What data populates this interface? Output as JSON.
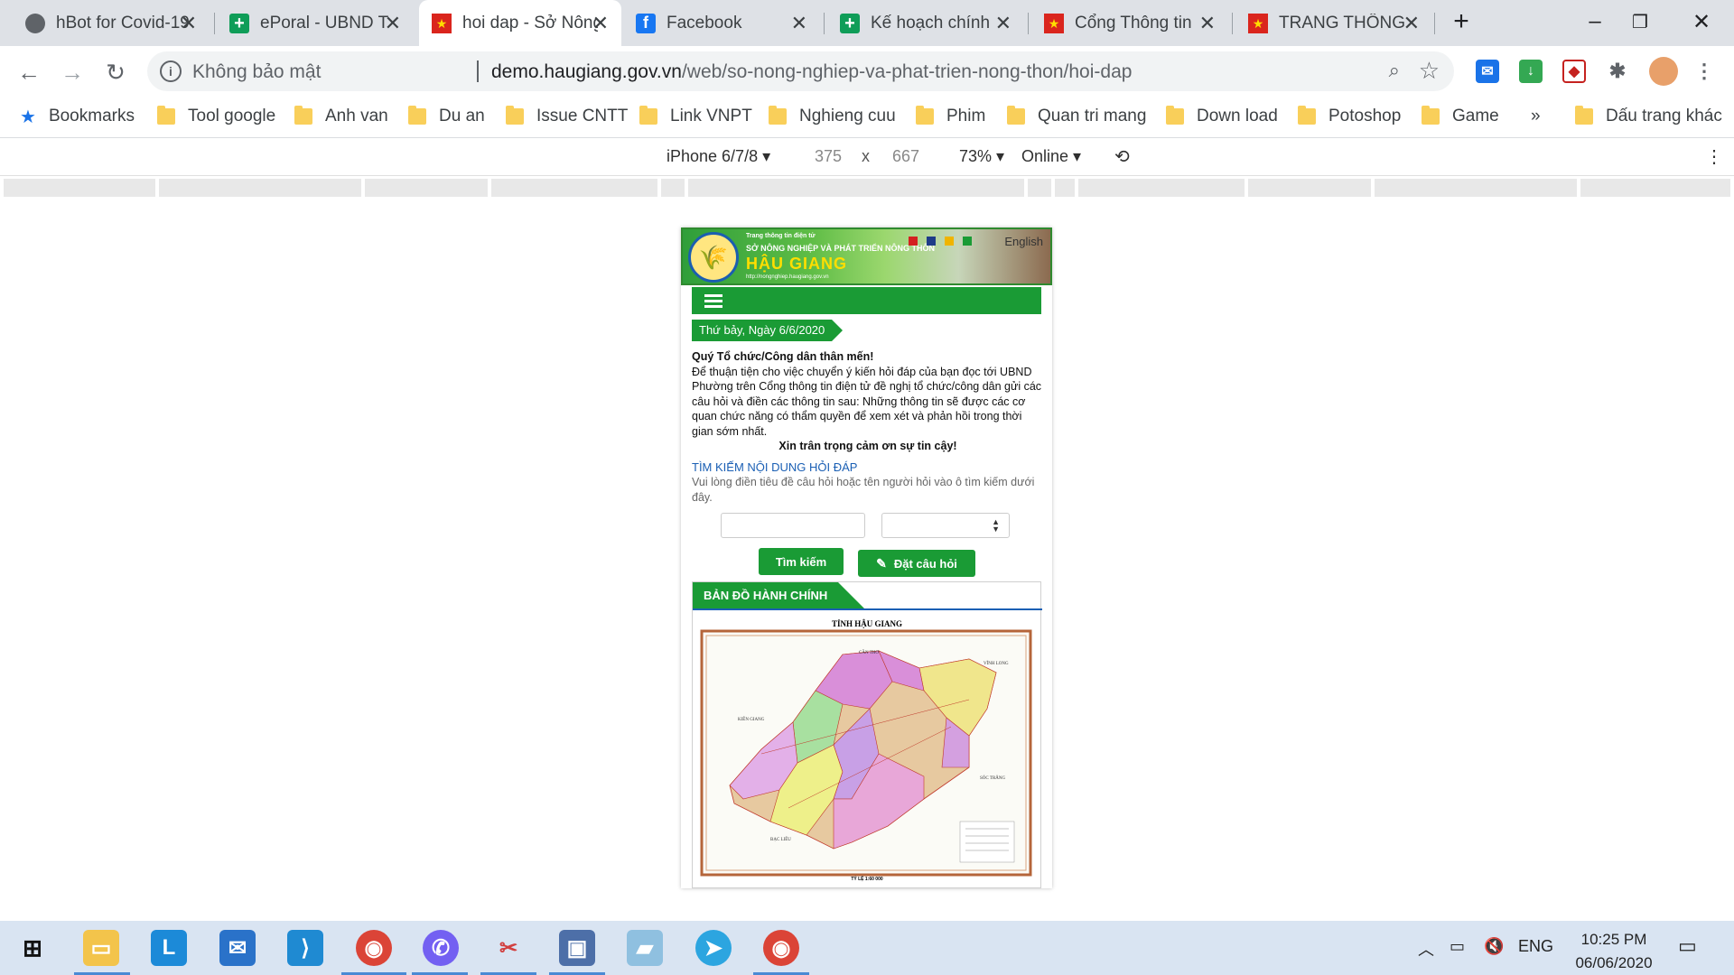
{
  "browser": {
    "tabs": [
      {
        "title": "hBot for Covid-19",
        "favicon": "globe-icon"
      },
      {
        "title": "ePoral - UBND T",
        "favicon": "sheet-icon"
      },
      {
        "title": "hoi dap - Sở Nông",
        "favicon": "vn-flag-icon"
      },
      {
        "title": "Facebook",
        "favicon": "facebook-icon"
      },
      {
        "title": "Kế hoạch chính",
        "favicon": "sheet-icon"
      },
      {
        "title": "Cổng Thông tin",
        "favicon": "vn-flag-icon"
      },
      {
        "title": "TRANG THÔNG",
        "favicon": "vn-flag-icon"
      }
    ],
    "new_tab": "+",
    "omnibox": {
      "security_text": "Không bảo mật",
      "host": "demo.haugiang.gov.vn",
      "path": "/web/so-nong-nghiep-va-phat-trien-nong-thon/hoi-dap"
    },
    "bookmarks": [
      {
        "label": "Bookmarks",
        "icon": "star-icon"
      },
      {
        "label": "Tool google"
      },
      {
        "label": "Anh van"
      },
      {
        "label": "Du an"
      },
      {
        "label": "Issue CNTT"
      },
      {
        "label": "Link VNPT"
      },
      {
        "label": "Nghieng cuu"
      },
      {
        "label": "Phim"
      },
      {
        "label": "Quan tri mang"
      },
      {
        "label": "Down load"
      },
      {
        "label": "Potoshop"
      },
      {
        "label": "Game"
      }
    ],
    "bookmarks_more": "»",
    "other_bookmarks": "Dấu trang khác"
  },
  "device_toolbar": {
    "device": "iPhone 6/7/8",
    "width": "375",
    "times": "x",
    "height": "667",
    "zoom": "73%",
    "network": "Online"
  },
  "page": {
    "banner": {
      "small_text": "Trang thông tin điện tử",
      "org": "SỞ NÔNG NGHIỆP VÀ PHÁT TRIỂN NÔNG THÔN",
      "province": "HẬU GIANG",
      "site": "http://nongnghiep.haugiang.gov.vn",
      "lang": "English"
    },
    "date": "Thứ bảy, Ngày 6/6/2020",
    "intro": {
      "greeting": "Quý Tổ chức/Công dân thân mến!",
      "body": "Để thuận tiện cho việc chuyển ý kiến hỏi đáp của bạn đọc tới UBND Phường trên Cổng thông tin điện tử đề nghị tổ chức/công dân gửi các câu hỏi và điền các thông tin sau: Những thông tin sẽ được các cơ quan chức năng có thẩm quyền để xem xét và phản hồi trong thời gian sớm nhất.",
      "thanks": "Xin trân trọng cảm ơn sự tin cậy!"
    },
    "search": {
      "title": "TÌM KIẾM NỘI DUNG HỎI ĐÁP",
      "hint": "Vui lòng điền tiêu đề câu hỏi hoặc tên người hỏi vào ô tìm kiếm dưới đây.",
      "search_button": "Tìm kiếm",
      "ask_button": "Đặt câu hỏi"
    },
    "map": {
      "heading": "BẢN ĐỒ HÀNH CHÍNH",
      "title": "TỈNH HẬU GIANG",
      "labels": [
        "CẦN THƠ",
        "VĨNH LONG",
        "KIÊN GIANG",
        "SÓC TRĂNG",
        "BẠC LIÊU"
      ],
      "scale": "TỶ LỆ 1:60 000"
    }
  },
  "taskbar": {
    "lang": "ENG",
    "time": "10:25 PM",
    "date": "06/06/2020"
  },
  "colors": {
    "green": "#1a9b35",
    "link_blue": "#1a5fb4",
    "chrome_tabbar": "#dee1e6"
  }
}
